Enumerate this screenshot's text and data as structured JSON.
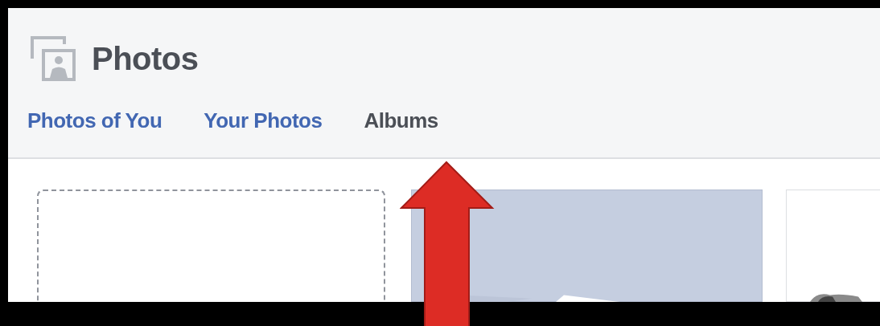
{
  "header": {
    "title": "Photos"
  },
  "tabs": [
    {
      "label": "Photos of You",
      "selected": false
    },
    {
      "label": "Your Photos",
      "selected": false
    },
    {
      "label": "Albums",
      "selected": true
    }
  ],
  "albums": [
    {
      "kind": "placeholder"
    },
    {
      "kind": "picture"
    },
    {
      "kind": "picture"
    }
  ],
  "annotations": [
    {
      "kind": "arrow"
    }
  ]
}
